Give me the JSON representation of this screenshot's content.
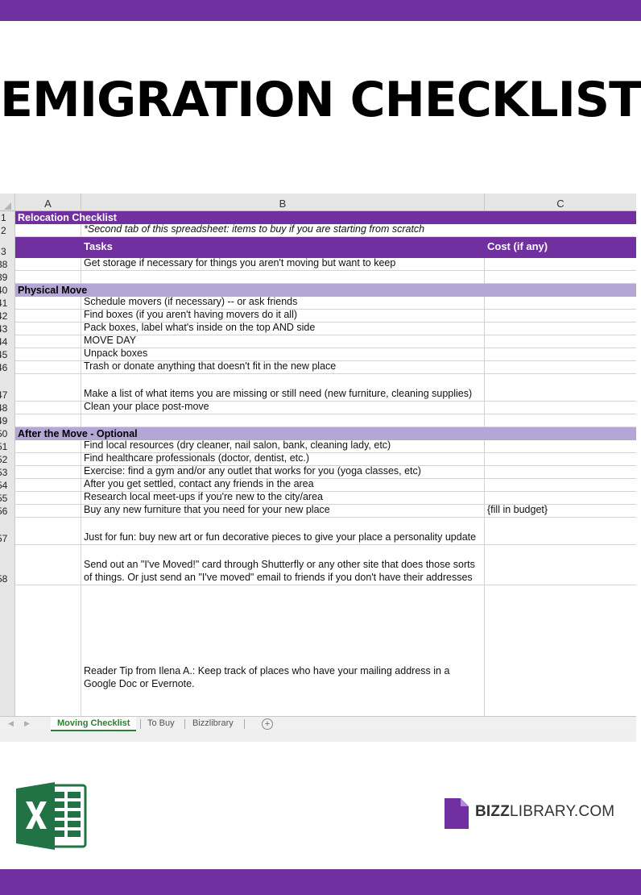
{
  "title": "EMIGRATION CHECKLIST",
  "columns": [
    "A",
    "B",
    "C"
  ],
  "rows": {
    "r1": {
      "num": "1",
      "text": "Relocation Checklist"
    },
    "r2": {
      "num": "2",
      "text": "*Second tab of this spreadsheet: items to buy if you are starting from scratch"
    },
    "r3": {
      "num": "3",
      "tasks": "Tasks",
      "cost": "Cost (if any)"
    },
    "r38": {
      "num": "38",
      "b": "Get storage if necessary for things you aren't moving but want to keep"
    },
    "r39": {
      "num": "39"
    },
    "r40": {
      "num": "40",
      "text": "Physical Move"
    },
    "r41": {
      "num": "41",
      "b": "Schedule movers (if necessary) -- or ask friends"
    },
    "r42": {
      "num": "42",
      "b": "Find boxes (if you aren't having movers do it all)"
    },
    "r43": {
      "num": "43",
      "b": "Pack boxes, label what's inside on the top AND side"
    },
    "r44": {
      "num": "44",
      "b": "MOVE DAY"
    },
    "r45": {
      "num": "45",
      "b": "Unpack boxes"
    },
    "r46": {
      "num": "46",
      "b": "Trash or donate anything that doesn't fit in the new place"
    },
    "r47": {
      "num": "47",
      "b": "Make a list of what items you are missing or still need (new furniture, cleaning supplies)"
    },
    "r48": {
      "num": "48",
      "b": "Clean your place post-move"
    },
    "r49": {
      "num": "49"
    },
    "r50": {
      "num": "50",
      "text": "After the Move - Optional"
    },
    "r51": {
      "num": "51",
      "b": "Find local resources (dry cleaner, nail salon, bank, cleaning lady, etc)"
    },
    "r52": {
      "num": "52",
      "b": "Find healthcare professionals (doctor, dentist, etc.)"
    },
    "r53": {
      "num": "53",
      "b": "Exercise: find a gym and/or any outlet that works for you (yoga classes, etc)"
    },
    "r54": {
      "num": "54",
      "b": "After you get settled, contact any friends in the area"
    },
    "r55": {
      "num": "55",
      "b": "Research local meet-ups if you're new to the city/area"
    },
    "r56": {
      "num": "56",
      "b": "Buy any new furniture that you need for your new place",
      "c": "{fill in budget}"
    },
    "r57": {
      "num": "57",
      "b": "Just for fun: buy new art or fun decorative pieces to give your place a personality update"
    },
    "r58": {
      "num": "58",
      "b": "Send out an \"I've Moved!\" card through Shutterfly or any other site that does those sorts of things. Or just send an \"I've moved\" email to friends if you don't have their addresses"
    },
    "r59": {
      "b": "Reader Tip from Ilena A.: Keep track of places who have your mailing address in a Google Doc or Evernote."
    }
  },
  "tabs": [
    "Moving Checklist",
    "To Buy",
    "Bizzlibrary"
  ],
  "add_sheet": "+",
  "logo": {
    "bold": "BIZZ",
    "rest": "LIBRARY.COM"
  },
  "icons": {
    "excel": "excel-icon",
    "bizz": "bizzlibrary-logo-icon"
  },
  "colors": {
    "purple": "#7030a0",
    "lavender": "#b4a7d6",
    "excel_green": "#217346"
  }
}
